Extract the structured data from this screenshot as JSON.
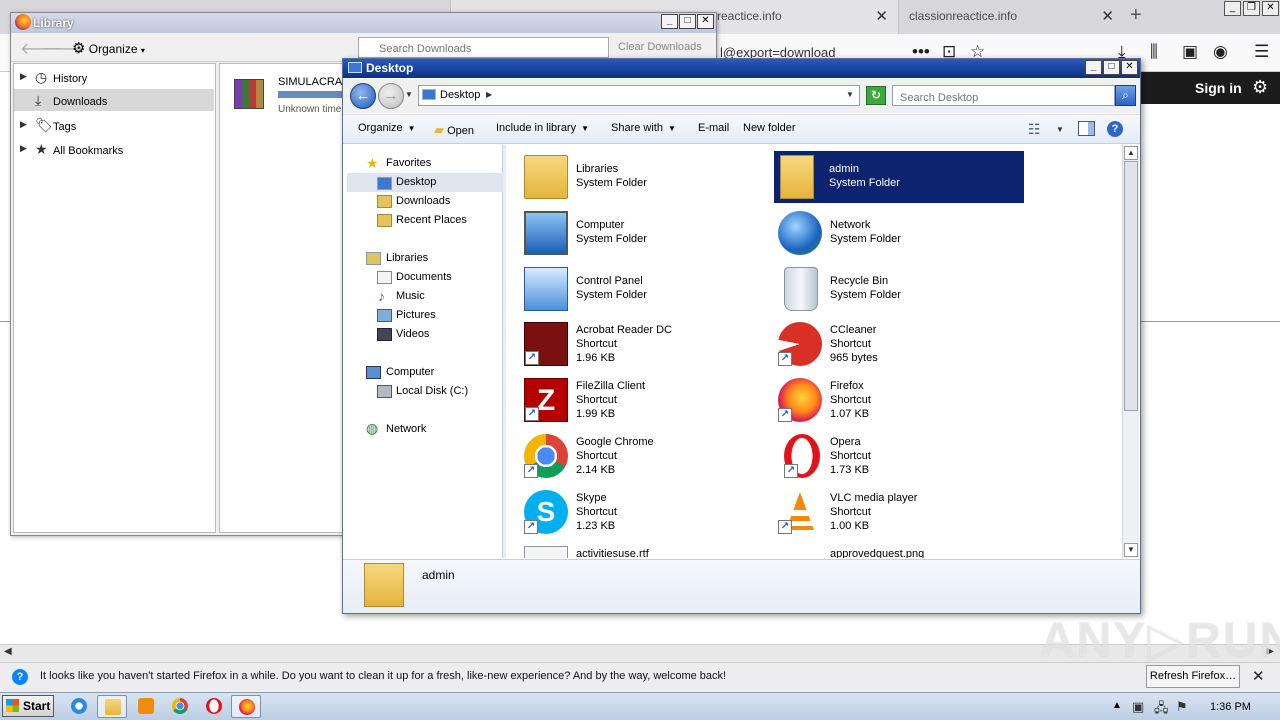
{
  "firefox": {
    "tabs": [
      {
        "label": "reactice.info"
      },
      {
        "label": "classionreactice.info"
      }
    ],
    "url_fragment": "l@export=download",
    "sign_in": "Sign in",
    "notification": {
      "text": "It looks like you haven't started Firefox in a while. Do you want to clean it up for a fresh, like-new experience? And by the way, welcome back!",
      "button": "Refresh Firefox…"
    }
  },
  "library": {
    "title": "Library",
    "organize": "Organize",
    "search_placeholder": "Search Downloads",
    "clear_label": "Clear Downloads",
    "tree": [
      {
        "label": "History"
      },
      {
        "label": "Downloads"
      },
      {
        "label": "Tags"
      },
      {
        "label": "All Bookmarks"
      }
    ],
    "download": {
      "name": "SIMULACRA.r",
      "status": "Unknown time"
    }
  },
  "explorer": {
    "title": "Desktop",
    "address": "Desktop",
    "search_placeholder": "Search Desktop",
    "commands": {
      "organize": "Organize",
      "open": "Open",
      "include": "Include in library",
      "share": "Share with",
      "email": "E-mail",
      "new_folder": "New folder"
    },
    "nav": {
      "favorites": "Favorites",
      "desktop": "Desktop",
      "downloads": "Downloads",
      "recent": "Recent Places",
      "libraries": "Libraries",
      "documents": "Documents",
      "music": "Music",
      "pictures": "Pictures",
      "videos": "Videos",
      "computer": "Computer",
      "local_disk": "Local Disk (C:)",
      "network": "Network"
    },
    "items": [
      {
        "name": "Libraries",
        "type": "System Folder"
      },
      {
        "name": "admin",
        "type": "System Folder"
      },
      {
        "name": "Computer",
        "type": "System Folder"
      },
      {
        "name": "Network",
        "type": "System Folder"
      },
      {
        "name": "Control Panel",
        "type": "System Folder"
      },
      {
        "name": "Recycle Bin",
        "type": "System Folder"
      },
      {
        "name": "Acrobat Reader DC",
        "type": "Shortcut",
        "size": "1.96 KB"
      },
      {
        "name": "CCleaner",
        "type": "Shortcut",
        "size": "965 bytes"
      },
      {
        "name": "FileZilla Client",
        "type": "Shortcut",
        "size": "1.99 KB"
      },
      {
        "name": "Firefox",
        "type": "Shortcut",
        "size": "1.07 KB"
      },
      {
        "name": "Google Chrome",
        "type": "Shortcut",
        "size": "2.14 KB"
      },
      {
        "name": "Opera",
        "type": "Shortcut",
        "size": "1.73 KB"
      },
      {
        "name": "Skype",
        "type": "Shortcut",
        "size": "1.23 KB"
      },
      {
        "name": "VLC media player",
        "type": "Shortcut",
        "size": "1.00 KB"
      },
      {
        "name": "activitiesuse.rtf"
      },
      {
        "name": "approvedguest.png"
      }
    ],
    "details_name": "admin"
  },
  "taskbar": {
    "start": "Start",
    "clock": "1:36 PM"
  },
  "watermark": "ANY RUN",
  "colors": {
    "selection": "#0c2370",
    "title_bar": "#0b2f86",
    "notification_bg": "#ededf0"
  }
}
